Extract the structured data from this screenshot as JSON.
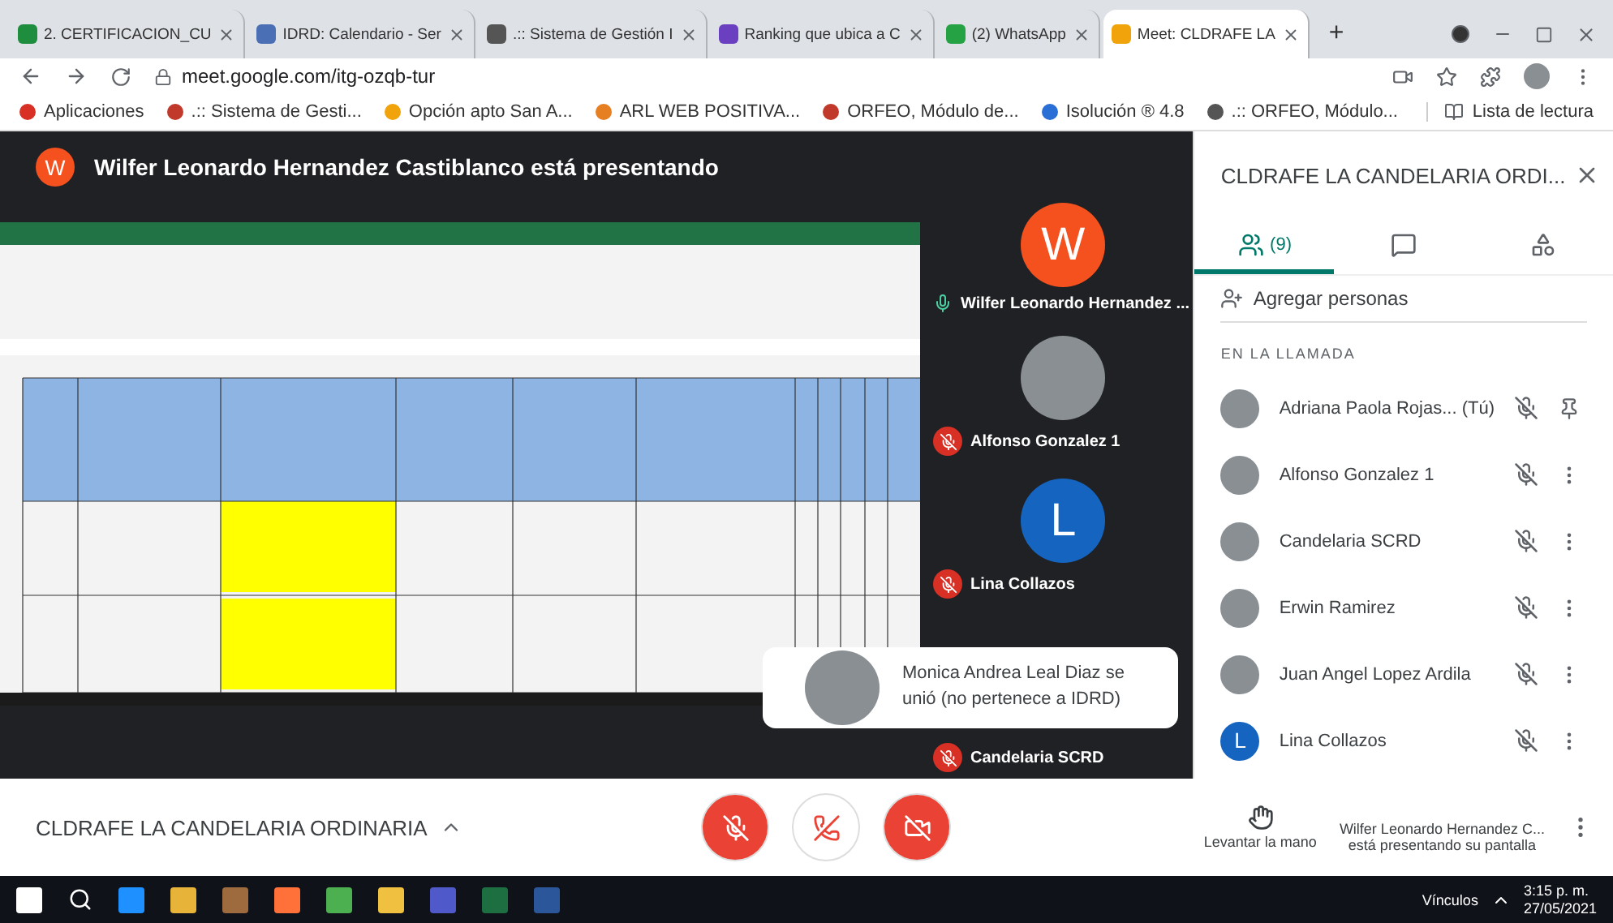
{
  "browser": {
    "tabs": [
      {
        "label": "2. CERTIFICACION_CU",
        "selected": false,
        "color": "#1e8e3e"
      },
      {
        "label": "IDRD: Calendario - Ser",
        "selected": false,
        "color": "#4a6fb5"
      },
      {
        "label": ".:: Sistema de Gestión I",
        "selected": false,
        "color": "#555555"
      },
      {
        "label": "Ranking que ubica a C",
        "selected": false,
        "color": "#6a3fc0"
      },
      {
        "label": "(2) WhatsApp",
        "selected": false,
        "color": "#25a244"
      },
      {
        "label": "Meet: CLDRAFE LA",
        "selected": true,
        "color": "#f0a30a"
      }
    ],
    "new_tab": "+",
    "url": "meet.google.com/itg-ozqb-tur",
    "bookmarks": [
      {
        "label": "Aplicaciones",
        "color": "#d93025"
      },
      {
        "label": ".:: Sistema de Gesti...",
        "color": "#c0392b"
      },
      {
        "label": "Opción apto San A...",
        "color": "#f0a30a"
      },
      {
        "label": "ARL WEB POSITIVA...",
        "color": "#e67e22"
      },
      {
        "label": "ORFEO, Módulo de...",
        "color": "#c0392b"
      },
      {
        "label": "Isolución ® 4.8",
        "color": "#2a6fd6"
      },
      {
        "label": ".:: ORFEO, Módulo...",
        "color": "#555555"
      }
    ],
    "reading_list": "Lista de lectura"
  },
  "presenter": {
    "initial": "W",
    "title": "Wilfer Leonardo Hernandez Castiblanco está presentando"
  },
  "tiles": [
    {
      "kind": "letter",
      "initial": "W",
      "color": "#f4511e",
      "name": "Wilfer Leonardo Hernandez ...",
      "muted": false
    },
    {
      "kind": "photo",
      "name": "Alfonso Gonzalez 1",
      "muted": true
    },
    {
      "kind": "letter",
      "initial": "L",
      "color": "#1565c0",
      "name": "Lina Collazos",
      "muted": true
    },
    {
      "kind": "none",
      "name": "Candelaria SCRD",
      "muted": true
    }
  ],
  "toast": {
    "text": "Monica Andrea Leal Diaz se unió (no pertenece a IDRD)"
  },
  "panel": {
    "title": "CLDRAFE LA CANDELARIA ORDI...",
    "tabs": [
      {
        "kind": "people",
        "label": "(9)",
        "selected": true
      },
      {
        "kind": "chat",
        "selected": false
      },
      {
        "kind": "activities",
        "selected": false
      }
    ],
    "add": "Agregar personas",
    "section": "EN LA LLAMADA",
    "people": [
      {
        "kind": "photo",
        "name": "Adriana Paola Rojas... (Tú)",
        "pinned": true
      },
      {
        "kind": "photo",
        "name": "Alfonso Gonzalez 1",
        "pinned": false
      },
      {
        "kind": "photo",
        "name": "Candelaria SCRD",
        "pinned": false
      },
      {
        "kind": "photo",
        "name": "Erwin Ramirez",
        "pinned": false
      },
      {
        "kind": "photo",
        "name": "Juan Angel Lopez Ardila",
        "pinned": false
      },
      {
        "kind": "letter",
        "initial": "L",
        "color": "#1565c0",
        "name": "Lina Collazos",
        "pinned": false
      }
    ]
  },
  "bottom": {
    "meeting": "CLDRAFE LA CANDELARIA ORDINARIA",
    "mic_on": false,
    "cam_on": false,
    "raise_hand": "Levantar la mano",
    "presenting_name": "Wilfer Leonardo Hernandez C...",
    "presenting_text": "está presentando su pantalla"
  },
  "taskbar": {
    "links": "Vínculos",
    "time": "3:15 p. m.",
    "date": "27/05/2021"
  }
}
